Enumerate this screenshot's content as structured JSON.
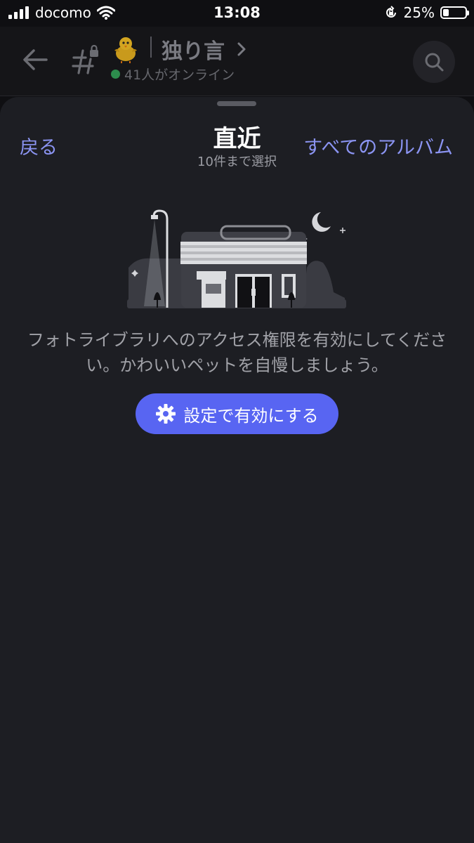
{
  "status_bar": {
    "carrier": "docomo",
    "time": "13:08",
    "battery_percent": "25%",
    "battery_level": 0.25
  },
  "chat_header": {
    "channel_emoji": "🐤",
    "channel_name": "独り言",
    "online_text": "41人がオンライン",
    "icons": [
      "back-arrow-icon",
      "locked-hash-icon",
      "chevron-right-icon",
      "search-icon"
    ]
  },
  "sheet": {
    "back_label": "戻る",
    "title": "直近",
    "subtitle": "10件まで選択",
    "all_albums_label": "すべてのアルバム",
    "message": "フォトライブラリへのアクセス権限を有効にしてください。かわいいペットを自慢しましょう。",
    "enable_button_label": "設定で有効にする",
    "enable_button_icon": "gear-icon"
  },
  "colors": {
    "accent": "#5865f2",
    "link": "#8b94f2",
    "sheet_background": "#1d1e23",
    "online": "#2d8c4d"
  }
}
